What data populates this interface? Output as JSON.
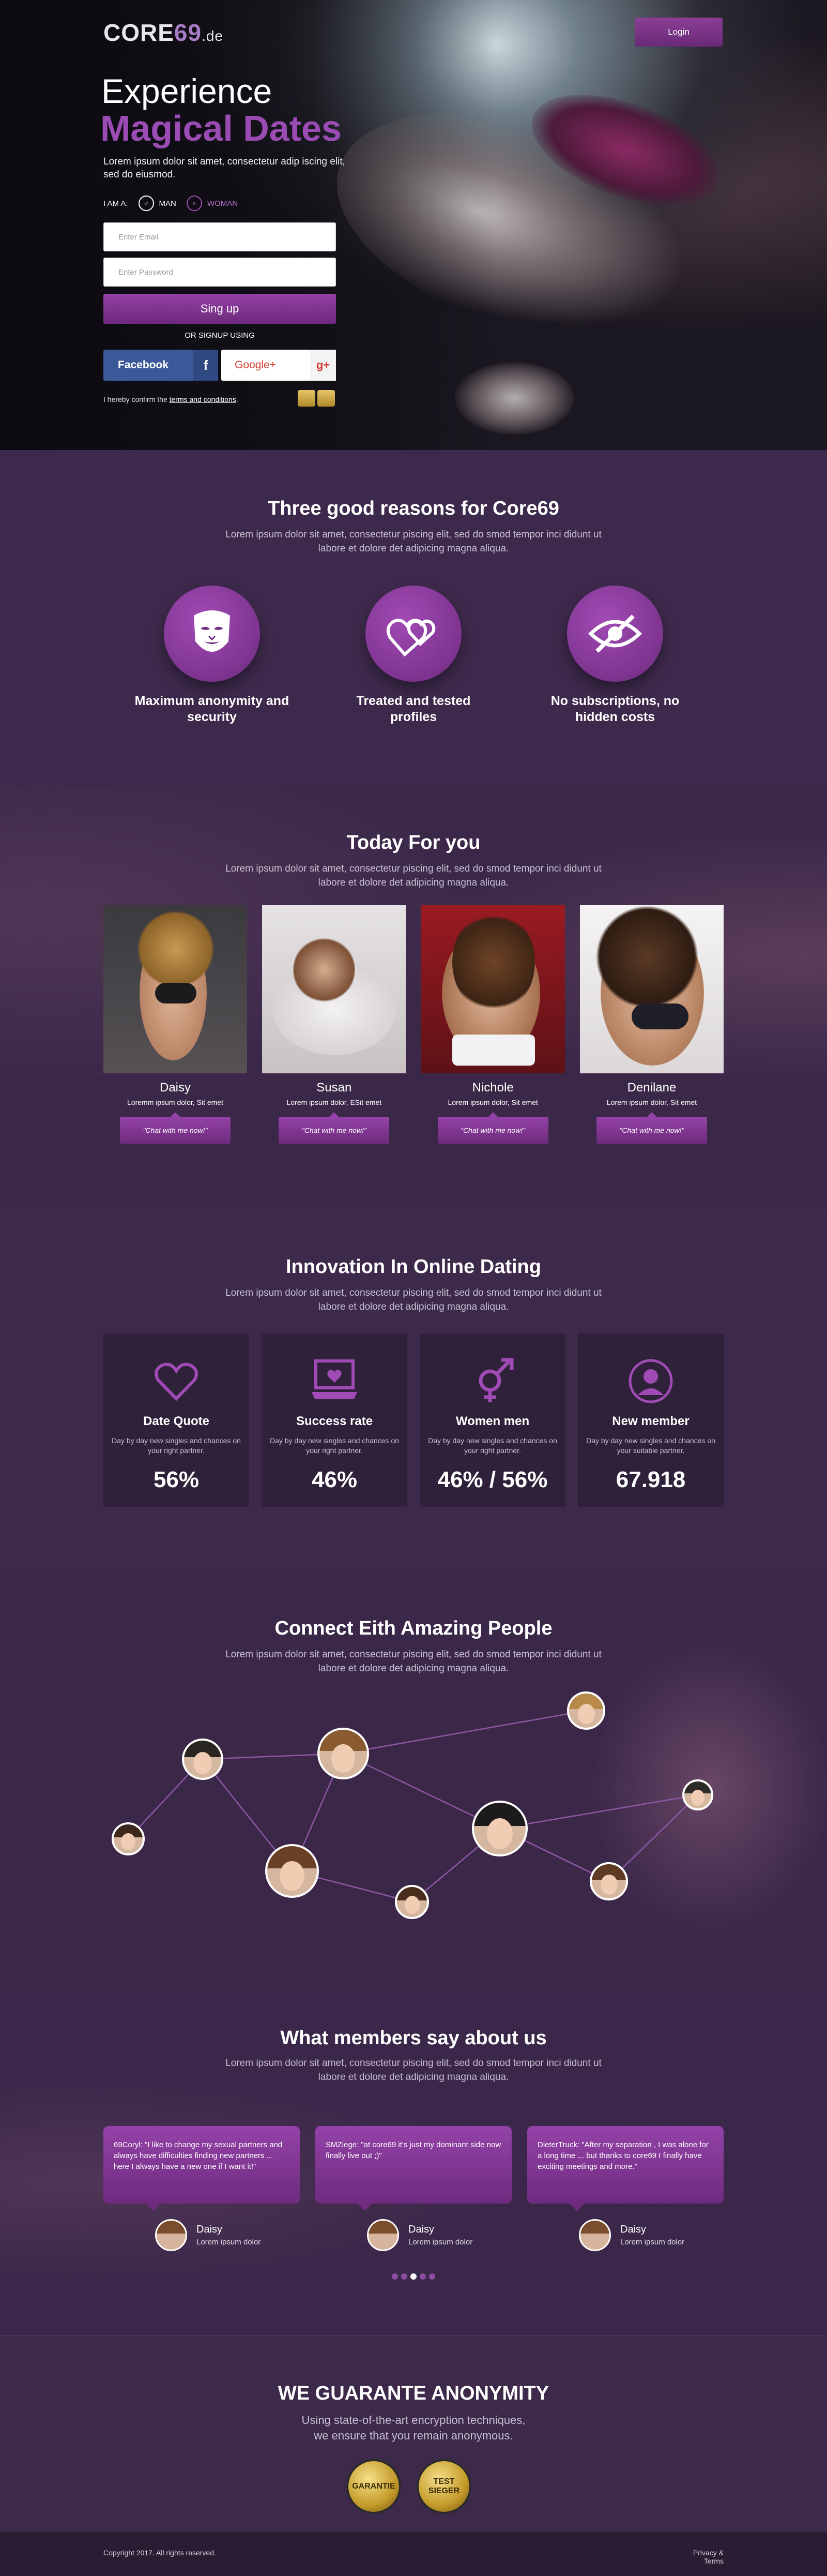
{
  "header": {
    "logo_main": "CORE",
    "logo_accent": "69",
    "logo_tld": ".de",
    "login_label": "Login"
  },
  "hero": {
    "title_line1": "Experience",
    "title_line2": "Magical Dates",
    "description": "Lorem ipsum dolor sit amet, consectetur adip iscing elit, sed do eiusmod.",
    "iam_label": "I AM A:",
    "man_label": "MAN",
    "woman_label": "WOMAN",
    "email_placeholder": "Enter Email",
    "password_placeholder": "Enter Password",
    "signup_label": "Sing up",
    "or_label": "OR SIGNUP USING",
    "facebook_label": "Facebook",
    "facebook_icon": "f",
    "google_label": "Google+",
    "google_icon": "g+",
    "confirm_prefix": "I hereby confirm the ",
    "confirm_link": "terms and conditions",
    "confirm_suffix": "."
  },
  "reasons": {
    "title": "Three good reasons for Core69",
    "description": "Lorem ipsum dolor sit amet, consectetur piscing elit, sed do smod tempor inci didunt ut labore et dolore det adipicing magna aliqua.",
    "items": [
      {
        "label": "Maximum anonymity and security",
        "icon": "mask-icon"
      },
      {
        "label": "Treated and tested profiles",
        "icon": "hearts-icon"
      },
      {
        "label": "No subscriptions, no hidden costs",
        "icon": "hidden-eye-icon"
      }
    ]
  },
  "today": {
    "title": "Today For you",
    "description": "Lorem ipsum dolor sit amet, consectetur piscing elit, sed do smod tempor inci didunt ut labore et dolore det adipicing magna aliqua.",
    "profiles": [
      {
        "name": "Daisy",
        "sub": "Loremm ipsum dolor, Sit emet",
        "chat": "\"Chat with me now!\""
      },
      {
        "name": "Susan",
        "sub": "Lorem ipsum dolor, ESit emet",
        "chat": "\"Chat with me now!\""
      },
      {
        "name": "Nichole",
        "sub": "Lorem ipsum dolor, Sit emet",
        "chat": "\"Chat with me now!\""
      },
      {
        "name": "Denilane",
        "sub": "Lorem ipsum dolor, Sit emet",
        "chat": "\"Chat with me now!\""
      }
    ]
  },
  "innovation": {
    "title": "Innovation In Online Dating",
    "description": "Lorem ipsum dolor sit amet, consectetur piscing elit, sed do smod tempor inci didunt ut labore et dolore det adipicing magna aliqua.",
    "stats": [
      {
        "title": "Date Quote",
        "desc": "Day by day new singles and chances on your right partner.",
        "value": "56%",
        "icon": "heart-outline-icon"
      },
      {
        "title": "Success rate",
        "desc": "Day by day new singles and chances on your right partner.",
        "value": "46%",
        "icon": "laptop-heart-icon"
      },
      {
        "title": "Women men",
        "desc": "Day by day new singles and chances on your right partner.",
        "value": "46% / 56%",
        "icon": "gender-icon"
      },
      {
        "title": "New member",
        "desc": "Day by day new singles and chances on your suitable partner.",
        "value": "67.918",
        "icon": "member-icon"
      }
    ]
  },
  "connect": {
    "title": "Connect Eith Amazing People",
    "description": "Lorem ipsum dolor sit amet, consectetur piscing elit, sed do smod tempor inci didunt ut labore et dolore det adipicing magna aliqua."
  },
  "testimonials": {
    "title": "What members say about us",
    "description": "Lorem ipsum dolor sit amet, consectetur piscing elit, sed do smod tempor inci didunt ut labore et dolore det adipicing magna aliqua.",
    "items": [
      {
        "text": "69Coryl: \"I like to change my sexual partners and always have difficulties finding new partners ... here I always have a new one if I want it!\"",
        "name": "Daisy",
        "role": "Lorem ipsum dolor"
      },
      {
        "text": "SMZiege: \"at core69 it's just my dominant side now finally live out ;)\"",
        "name": "Daisy",
        "role": "Lorem ipsum dolor"
      },
      {
        "text": "DieterTruck: \"After my separation , I was alone for a long time ... but thanks to core69 I finally have exciting meetings and more.\"",
        "name": "Daisy",
        "role": "Lorem ipsum dolor"
      }
    ]
  },
  "guarantee": {
    "title": "WE GUARANTE ANONYMITY",
    "line1": "Using state-of-the-art encryption techniques,",
    "line2": "we ensure that you remain anonymous.",
    "seal1": "GARANTIE",
    "seal2": "TEST SIEGER"
  },
  "footer": {
    "copyright": "Copyright 2017. All rights reserved.",
    "privacy": "Privacy & Terms"
  },
  "colors": {
    "accent": "#9b4cb4",
    "background": "#3a2748",
    "facebook": "#3b5998",
    "google": "#d23c2e"
  }
}
